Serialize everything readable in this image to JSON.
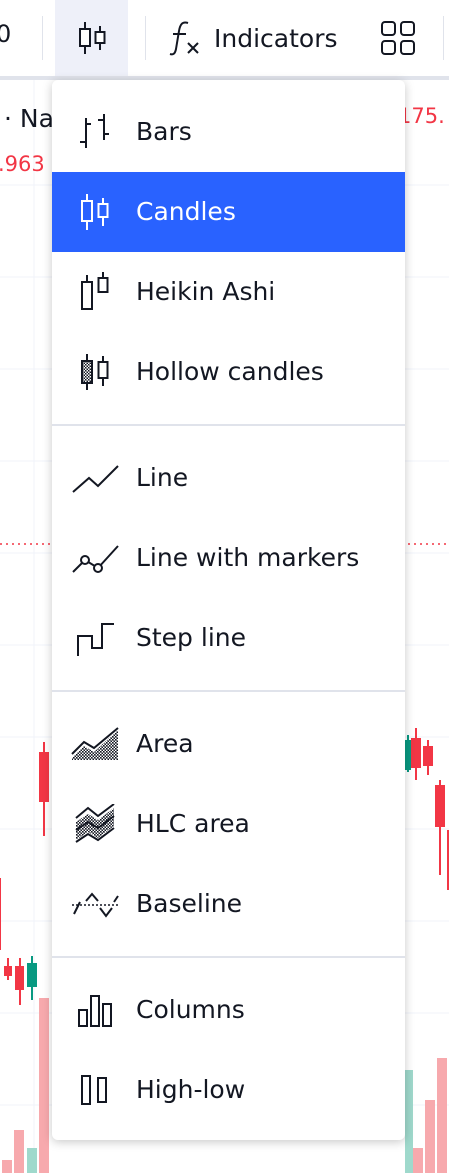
{
  "toolbar": {
    "partial_left_text": "0",
    "indicators_label": "Indicators",
    "icons": [
      "candles-icon",
      "function-icon",
      "layout-grid-icon"
    ]
  },
  "chart": {
    "legend_name": "· Na",
    "legend_price_left": ".963",
    "legend_price_right": "175.",
    "colors": {
      "up": "#089981",
      "down": "#f23645",
      "up_volume": "#9fd9cc",
      "down_volume": "#f7a9ad"
    }
  },
  "menu": {
    "selected": "Candles",
    "groups": [
      [
        {
          "label": "Bars",
          "icon": "bars-icon"
        },
        {
          "label": "Candles",
          "icon": "candles-icon"
        },
        {
          "label": "Heikin Ashi",
          "icon": "heikin-ashi-icon"
        },
        {
          "label": "Hollow candles",
          "icon": "hollow-candles-icon"
        }
      ],
      [
        {
          "label": "Line",
          "icon": "line-icon"
        },
        {
          "label": "Line with markers",
          "icon": "line-markers-icon"
        },
        {
          "label": "Step line",
          "icon": "step-line-icon"
        }
      ],
      [
        {
          "label": "Area",
          "icon": "area-icon"
        },
        {
          "label": "HLC area",
          "icon": "hlc-area-icon"
        },
        {
          "label": "Baseline",
          "icon": "baseline-icon"
        }
      ],
      [
        {
          "label": "Columns",
          "icon": "columns-icon"
        },
        {
          "label": "High-low",
          "icon": "high-low-icon"
        }
      ]
    ]
  }
}
